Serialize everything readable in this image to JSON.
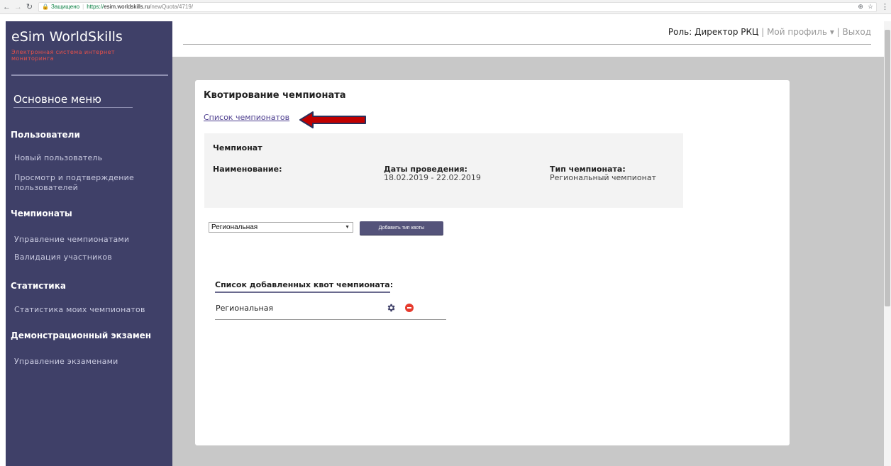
{
  "browser": {
    "secure_label": "Защищено",
    "url_scheme": "https://",
    "url_host": "esim.worldskills.ru",
    "url_path": "/newQuota/4719/"
  },
  "sidebar": {
    "logo_title": "eSim WorldSkills",
    "logo_subtitle": "Электронная система интернет мониторинга",
    "menu_title": "Основное меню",
    "sections": {
      "users": "Пользователи",
      "champs": "Чемпионаты",
      "stats": "Статистика",
      "demo": "Демонстрационный экзамен"
    },
    "items": {
      "new_user": "Новый пользователь",
      "view_users": "Просмотр и подтверждение пользователей",
      "manage_champs": "Управление чемпионатами",
      "validate": "Валидация участников",
      "my_stats": "Статистика моих чемпионатов",
      "manage_exams": "Управление экзаменами"
    }
  },
  "header": {
    "role": "Роль: Директор РКЦ",
    "divider": "|",
    "profile": "Мой профиль",
    "profile_caret": "▾",
    "logout": "Выход"
  },
  "main": {
    "title": "Квотирование чемпионата",
    "back_link": "Список чемпионатов",
    "championship": {
      "heading": "Чемпионат",
      "name_label": "Наименование:",
      "dates_label": "Даты проведения:",
      "dates_value": "18.02.2019 - 22.02.2019",
      "type_label": "Тип чемпионата:",
      "type_value": "Региональный чемпионат"
    },
    "quota_select": {
      "selected": "Региональная"
    },
    "add_button": "Добавить тип квоты",
    "list_title": "Список добавленных квот чемпионата:",
    "quotas": [
      {
        "name": "Региональная"
      }
    ]
  },
  "colors": {
    "sidebar_bg": "#3f4068",
    "accent_red": "#e8504a",
    "button_bg": "#54537a",
    "content_bg": "#c8c8c8",
    "annotation_arrow": "#c00000"
  },
  "icons": [
    "back-arrow-icon",
    "forward-arrow-icon",
    "reload-icon",
    "lock-icon",
    "zoom-icon",
    "star-icon",
    "menu-dots-icon",
    "gear-icon",
    "remove-icon"
  ]
}
